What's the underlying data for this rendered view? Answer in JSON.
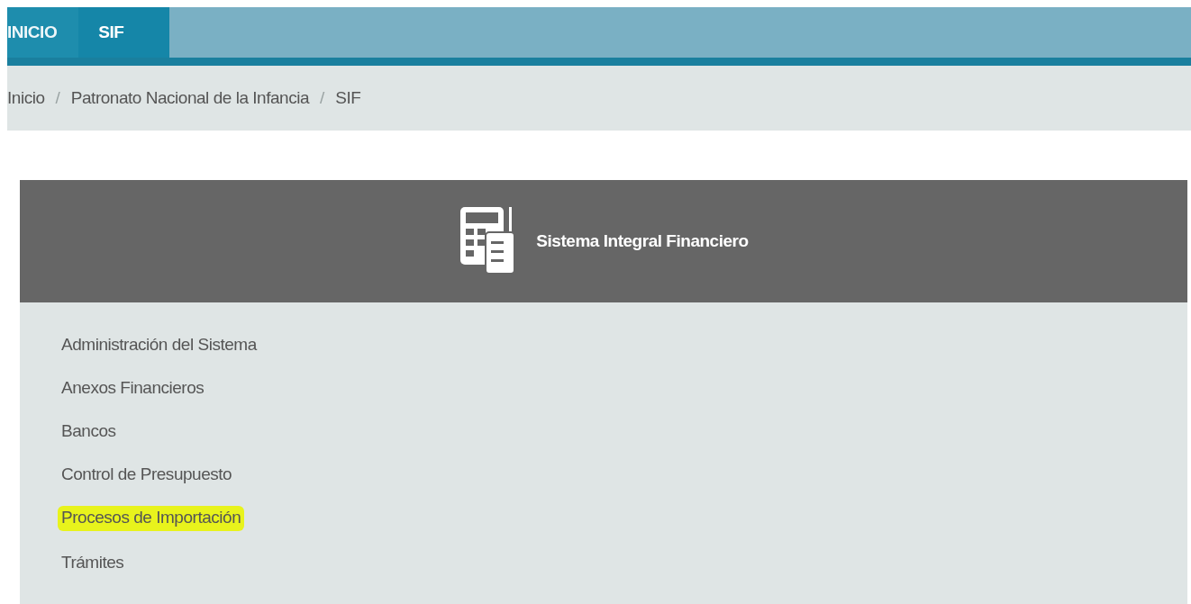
{
  "nav": {
    "tabs": [
      {
        "label": "INICIO",
        "selected": false
      },
      {
        "label": "SIF",
        "selected": true
      }
    ]
  },
  "breadcrumb": [
    {
      "kind": "link",
      "text": "Inicio"
    },
    {
      "kind": "separator",
      "text": "/"
    },
    {
      "kind": "link",
      "text": "Patronato Nacional de la Infancia"
    },
    {
      "kind": "separator",
      "text": "/"
    },
    {
      "kind": "link",
      "text": "SIF"
    }
  ],
  "panel": {
    "title": "Sistema Integral Financiero",
    "items": [
      {
        "label": "Administración del Sistema",
        "highlighted": false
      },
      {
        "label": "Anexos Financieros",
        "highlighted": false
      },
      {
        "label": "Bancos",
        "highlighted": false
      },
      {
        "label": "Control de Presupuesto",
        "highlighted": false
      },
      {
        "label": "Procesos de Importación",
        "highlighted": true
      },
      {
        "label": "Trámites",
        "highlighted": false
      }
    ]
  }
}
